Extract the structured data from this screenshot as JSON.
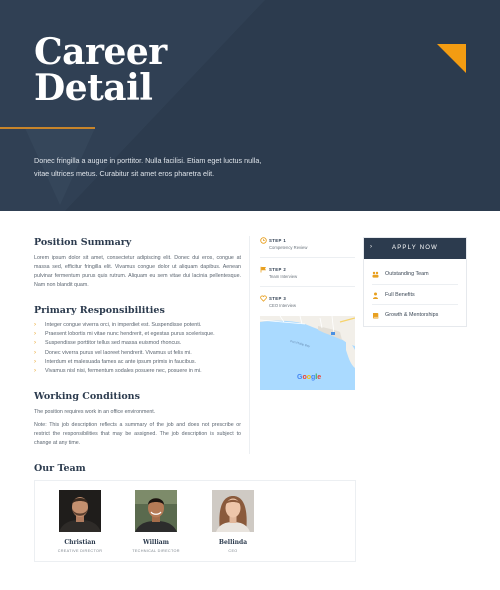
{
  "hero": {
    "title_line1": "Career",
    "title_line2": "Detail",
    "description": "Donec fringilla a augue in porttitor. Nulla facilisi. Etiam eget luctus nulla, vitae ultrices metus. Curabitur sit amet eros pharetra elit."
  },
  "summary": {
    "heading": "Position Summary",
    "body": "Lorem ipsum dolor sit amet, consectetur adipiscing elit. Donec dui eros, congue at massa sed, efficitur fringilla elit. Vivamus congue dolor ut aliquam dapibus. Aenean pulvinar fermentum purus quis rutrum. Aliquam eu sem vitae dui lacinia pellentesque. Nam non blandit quam."
  },
  "responsibilities": {
    "heading": "Primary Responsibilities",
    "items": [
      "Integer congue viverra orci, in imperdiet est. Suspendisse potenti.",
      "Praesent lobortis mi vitae nunc hendrerit, et egestas purus scelerisque.",
      "Suspendisse porttitor tellus sed massa euismod rhoncus.",
      "Donec viverra purus vel laoreet hendrerit. Vivamus ut felis mi.",
      "Interdum et malesuada fames ac ante ipsum primis in faucibus.",
      "Vivamus nisl nisi, fermentum sodales posuere nec, posuere in mi."
    ],
    "bullet_icon": "chevron-right-icon"
  },
  "conditions": {
    "heading": "Working Conditions",
    "line1": "The position requires work in an office environment.",
    "note": "Note:  This job description reflects a summary of the job and does not prescribe or restrict the responsibilities that may be assigned.   The job description is subject to change at any time."
  },
  "steps": [
    {
      "label": "STEP 1",
      "sub": "Competency Review",
      "icon": "clock-icon"
    },
    {
      "label": "STEP 2",
      "sub": "Team Interview",
      "icon": "flag-icon"
    },
    {
      "label": "STEP 3",
      "sub": "CEO Interview",
      "icon": "heart-icon"
    }
  ],
  "map": {
    "street_label": "Port Phillip Bay",
    "google_letters": [
      "G",
      "o",
      "o",
      "g",
      "l",
      "e"
    ],
    "google_colors": [
      "#4285F4",
      "#EA4335",
      "#FBBC05",
      "#4285F4",
      "#34A853",
      "#EA4335"
    ]
  },
  "apply": {
    "button_label": "APPLY NOW",
    "arrow": "›",
    "perks": [
      {
        "label": "Outstanding Team",
        "icon": "team-icon"
      },
      {
        "label": "Full Benefits",
        "icon": "person-icon"
      },
      {
        "label": "Growth & Mentorships",
        "icon": "book-icon"
      }
    ]
  },
  "team": {
    "heading": "Our Team",
    "members": [
      {
        "name": "Christian",
        "role": "CREATIVE DIRECTOR"
      },
      {
        "name": "William",
        "role": "TECHNICAL DIRECTOR"
      },
      {
        "name": "Bellinda",
        "role": "CEO"
      }
    ]
  },
  "colors": {
    "navy": "#2c3b4e",
    "accent": "#e8a020",
    "hero_orange": "#f39c12"
  }
}
